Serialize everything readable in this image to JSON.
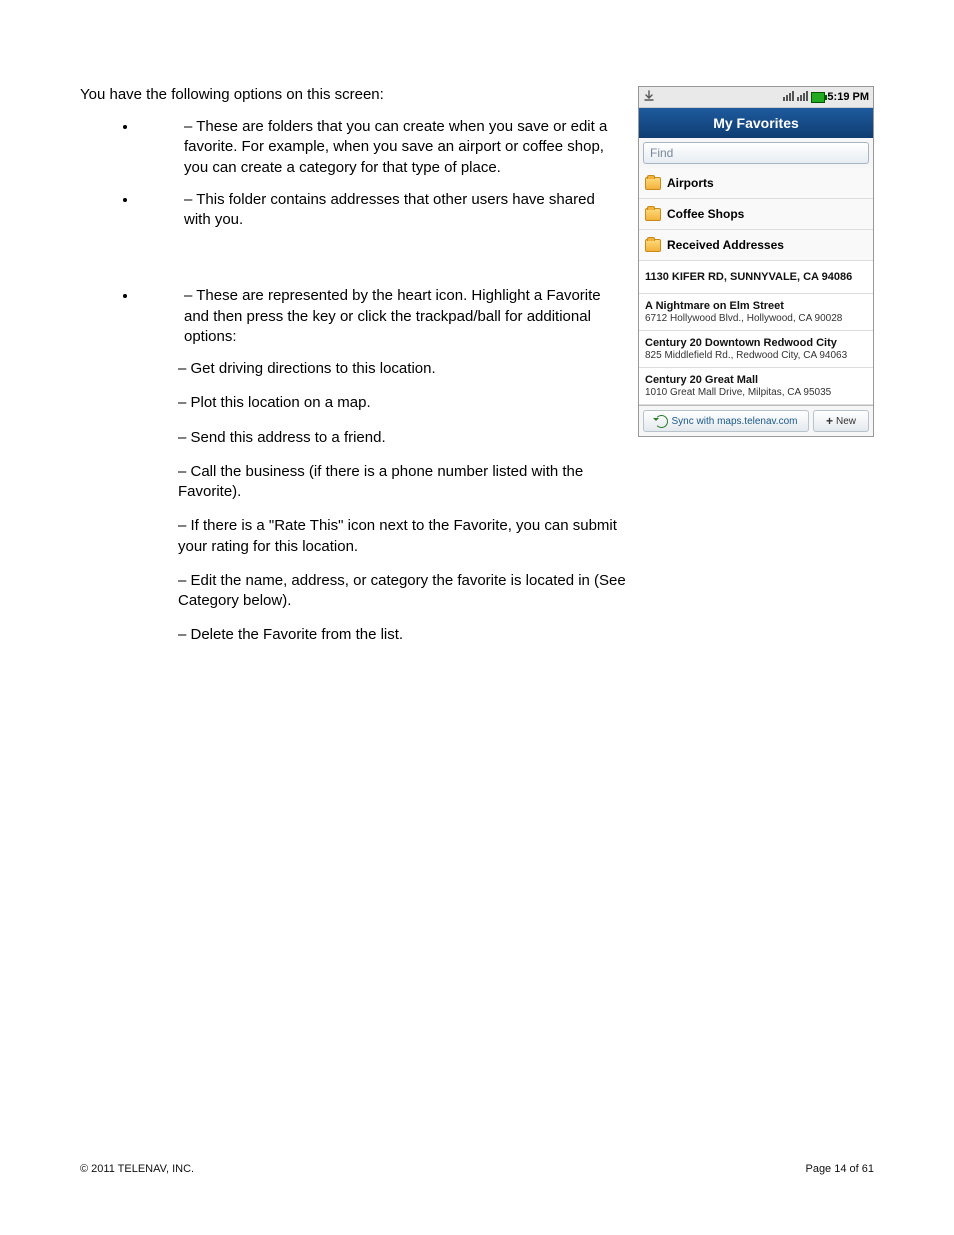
{
  "doc": {
    "intro": "You have the following options on this screen:",
    "bullet1": " – These are folders that you can create when you save or edit a favorite. For example, when you save an airport or coffee shop, you can create a category for that type of place.",
    "bullet2": " – This folder contains addresses that other users have shared with you.",
    "bullet3a": " – These are represented by the heart icon. Highlight a Favorite and then press the ",
    "bullet3b": " key or click the trackpad/ball for additional options:",
    "sub1": " – Get driving directions to this location.",
    "sub2": " – Plot this location on a map.",
    "sub3": " – Send this address to a friend.",
    "sub4": " – Call the business (if there is a phone number listed with the Favorite).",
    "sub5": " – If there is a \"Rate This\" icon next to the Favorite, you can submit your rating for this location.",
    "sub6": " – Edit the name, address, or category the favorite is located in (See Category below).",
    "sub7": " – Delete the Favorite from the list."
  },
  "device": {
    "time": "5:19 PM",
    "title": "My Favorites",
    "find_placeholder": "Find",
    "folders": [
      "Airports",
      "Coffee Shops",
      "Received Addresses"
    ],
    "rows": [
      {
        "title": "1130 KIFER RD, SUNNYVALE, CA 94086",
        "sub": ""
      },
      {
        "title": "A Nightmare on Elm Street",
        "sub": "6712 Hollywood Blvd., Hollywood, CA 90028"
      },
      {
        "title": "Century 20 Downtown Redwood City",
        "sub": "825 Middlefield Rd., Redwood City, CA 94063"
      },
      {
        "title": "Century 20 Great Mall",
        "sub": "1010 Great Mall Drive, Milpitas, CA 95035"
      }
    ],
    "sync_label": "Sync with maps.telenav.com",
    "new_label": "New"
  },
  "footer": {
    "copyright": "© 2011 TELENAV, INC.",
    "page": "Page 14 of 61"
  }
}
